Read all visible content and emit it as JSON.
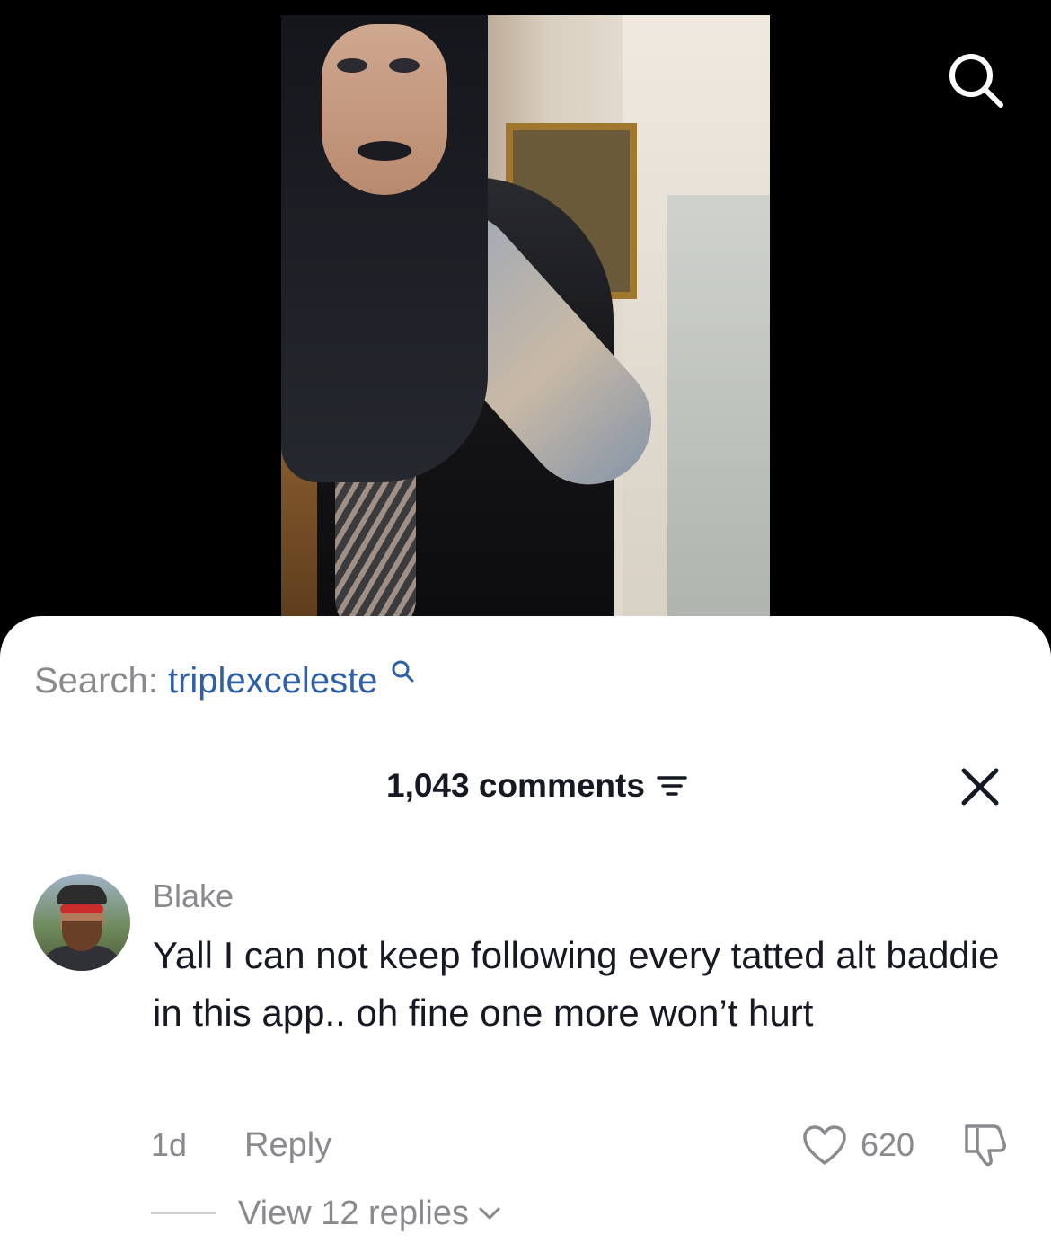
{
  "search": {
    "prefix": "Search:",
    "query": "triplexceleste"
  },
  "comments_header": {
    "count_label": "1,043 comments"
  },
  "icons": {
    "top_search": "search-icon",
    "sort": "filter-lines-icon",
    "close": "close-icon",
    "like": "heart-icon",
    "dislike": "thumbs-down-icon",
    "expand": "chevron-down-icon"
  },
  "comment": {
    "username": "Blake",
    "text": "Yall I can not keep following every tatted alt baddie in this app.. oh fine one more won’t hurt",
    "time": "1d",
    "reply_label": "Reply",
    "like_count": "620",
    "view_replies": "View 12 replies"
  },
  "colors": {
    "link_blue": "#2f5fa7",
    "muted_gray": "#8a8a8e",
    "text_dark": "#161823",
    "sheet_bg": "#ffffff"
  }
}
